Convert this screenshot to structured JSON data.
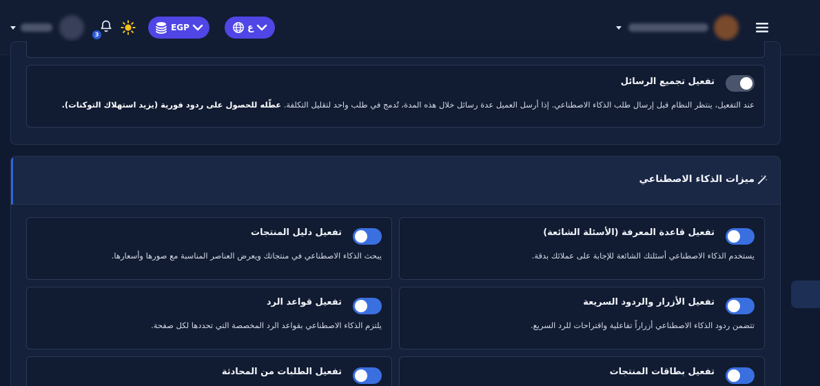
{
  "header": {
    "currency_label": "EGP",
    "language_label": "ع",
    "notifications_count": "3"
  },
  "message_grouping": {
    "title": "تفعيل تجميع الرسائل",
    "desc_normal": "عند التفعيل، ينتظر النظام قبل إرسال طلب الذكاء الاصطناعي. إذا أرسل العميل عدة رسائل خلال هذه المدة، تُدمج في طلب واحد لتقليل التكلفة.",
    "desc_bold": "عطّله للحصول على ردود فورية (يزيد استهلاك التوكنات).",
    "enabled": false
  },
  "ai_features": {
    "section_title": "ميزات الذكاء الاصطناعي",
    "icon": "magic-wand-icon",
    "items": [
      {
        "title": "تفعيل قاعدة المعرفة (الأسئلة الشائعة)",
        "desc": "يستخدم الذكاء الاصطناعي أسئلتك الشائعة للإجابة على عملائك بدقة.",
        "enabled": true
      },
      {
        "title": "تفعيل دليل المنتجات",
        "desc": "يبحث الذكاء الاصطناعي في منتجاتك ويعرض العناصر المناسبة مع صورها وأسعارها.",
        "enabled": true
      },
      {
        "title": "تفعيل الأزرار والردود السريعة",
        "desc": "تتضمن ردود الذكاء الاصطناعي أزراراً تفاعلية واقتراحات للرد السريع.",
        "enabled": true
      },
      {
        "title": "تفعيل قواعد الرد",
        "desc": "يلتزم الذكاء الاصطناعي بقواعد الرد المخصصة التي تحددها لكل صفحة.",
        "enabled": true
      },
      {
        "title": "تفعيل بطاقات المنتجات",
        "desc": "",
        "enabled": true
      },
      {
        "title": "تفعيل الطلبات من المحادثة",
        "desc": "",
        "enabled": true
      }
    ]
  },
  "colors": {
    "background": "#0f1a30",
    "accent": "#4f46e5",
    "toggle_on": "#3a6fe0",
    "toggle_off": "#4a556d"
  }
}
